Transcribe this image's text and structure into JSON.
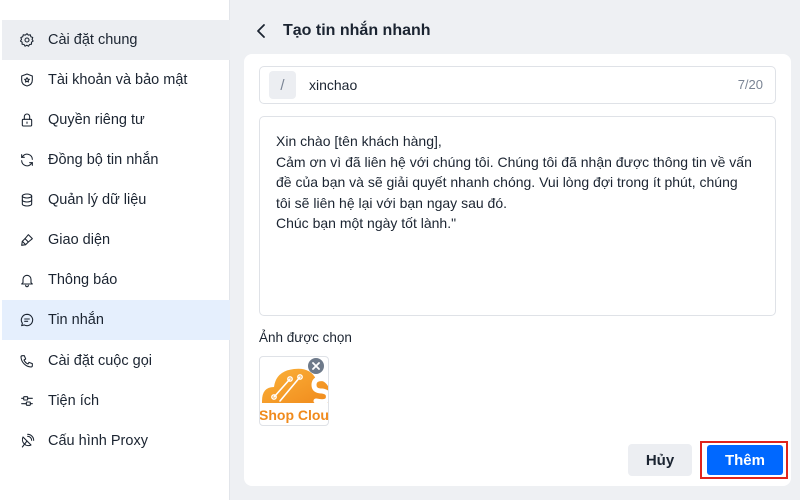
{
  "sidebar": {
    "items": [
      {
        "label": "Cài đặt chung",
        "icon": "gear-icon"
      },
      {
        "label": "Tài khoản và bảo mật",
        "icon": "shield-icon"
      },
      {
        "label": "Quyền riêng tư",
        "icon": "lock-icon"
      },
      {
        "label": "Đồng bộ tin nhắn",
        "icon": "sync-icon"
      },
      {
        "label": "Quản lý dữ liệu",
        "icon": "database-icon"
      },
      {
        "label": "Giao diện",
        "icon": "paint-brush-icon"
      },
      {
        "label": "Thông báo",
        "icon": "bell-icon"
      },
      {
        "label": "Tin nhắn",
        "icon": "message-icon"
      },
      {
        "label": "Cài đặt cuộc gọi",
        "icon": "phone-icon"
      },
      {
        "label": "Tiện ích",
        "icon": "utilities-icon"
      },
      {
        "label": "Cấu hình Proxy",
        "icon": "proxy-icon"
      }
    ],
    "active_hover": "Cài đặt chung",
    "selected": "Tin nhắn"
  },
  "header": {
    "title": "Tạo tin nhắn nhanh",
    "back_icon": "chevron-left-icon"
  },
  "form": {
    "shortcut_prefix": "/",
    "shortcut_value": "xinchao",
    "char_count": "7/20",
    "message": "Xin chào [tên khách hàng],\nCảm ơn vì đã liên hệ với chúng tôi. Chúng tôi đã nhận được thông tin về vấn\nđề của bạn và sẽ giải quyết nhanh chóng. Vui lòng đợi trong ít phút, chúng\ntôi sẽ liên hệ lại với bạn ngay sau đó.\nChúc bạn một ngày tốt lành.\"",
    "images_label": "Ảnh được chọn",
    "image_caption": "Shop Cloud",
    "brand_color": "#f7941d"
  },
  "actions": {
    "cancel_label": "Hủy",
    "add_label": "Thêm",
    "primary_color": "#0068ff",
    "highlight_color": "#e0241b"
  }
}
